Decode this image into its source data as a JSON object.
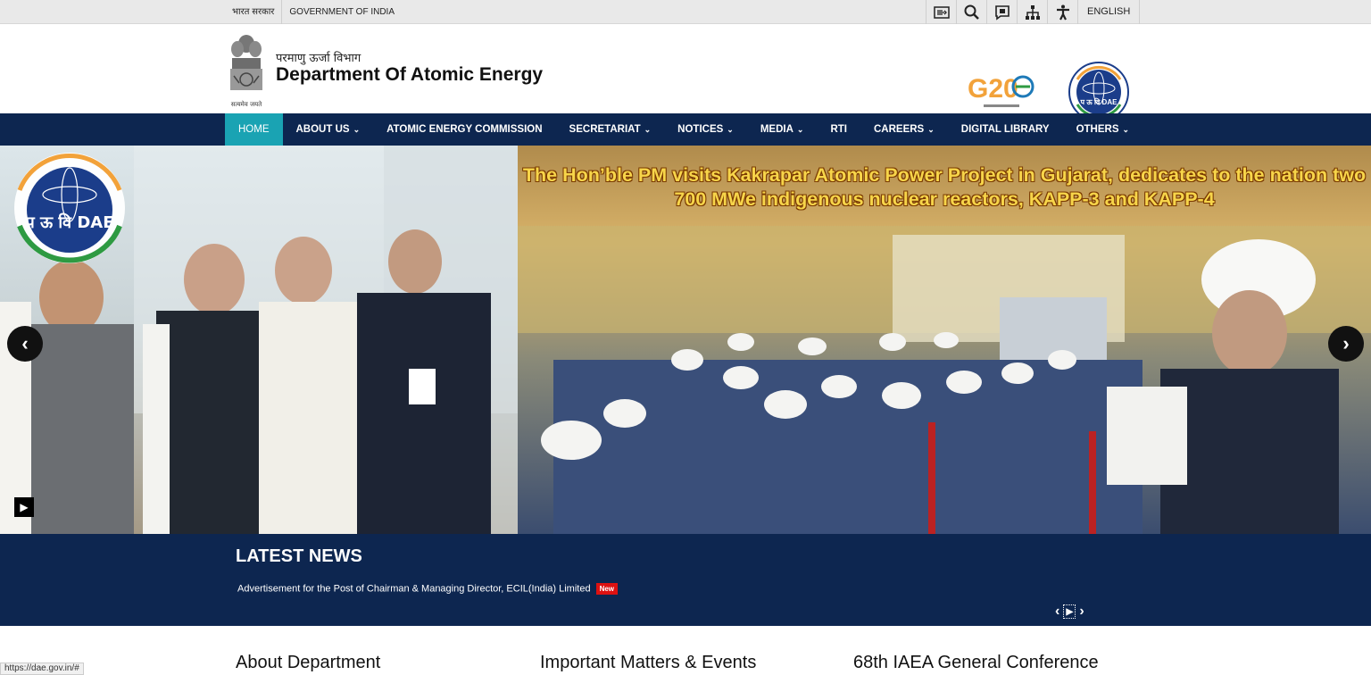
{
  "topbar": {
    "gov_hindi": "भारत सरकार",
    "gov_english": "GOVERNMENT OF INDIA",
    "tools": [
      "skip-to-content-icon",
      "search-icon",
      "screen-reader-icon",
      "sitemap-icon",
      "accessibility-icon"
    ],
    "language": "ENGLISH"
  },
  "header": {
    "emblem_motto": "सत्यमेव जयते",
    "dept_hindi": "परमाणु ऊर्जा विभाग",
    "dept_name": "Department Of Atomic Energy",
    "g20_text": "G20",
    "dae_logo_text": "प ऊ वि DAE"
  },
  "nav": {
    "items": [
      {
        "label": "HOME",
        "active": true
      },
      {
        "label": "ABOUT US",
        "dropdown": true
      },
      {
        "label": "ATOMIC ENERGY COMMISSION"
      },
      {
        "label": "SECRETARIAT",
        "dropdown": true
      },
      {
        "label": "NOTICES",
        "dropdown": true
      },
      {
        "label": "MEDIA",
        "dropdown": true
      },
      {
        "label": "RTI"
      },
      {
        "label": "CAREERS",
        "dropdown": true
      },
      {
        "label": "DIGITAL LIBRARY"
      },
      {
        "label": "OTHERS",
        "dropdown": true
      }
    ]
  },
  "slider": {
    "caption": "The Hon’ble PM visits Kakrapar Atomic Power Project in Gujarat, dedicates to the nation two 700 MWe indigenous nuclear reactors, KAPP-3 and KAPP-4",
    "logo_text": "प ऊ वि DAE"
  },
  "news": {
    "title": "LATEST NEWS",
    "item": "Advertisement for the Post of Chairman & Managing Director, ECIL(India) Limited",
    "badge": "New"
  },
  "sections": {
    "about": "About Department",
    "matters": "Important Matters & Events",
    "iaea": "68th IAEA General Conference"
  },
  "status_url": "https://dae.gov.in/#",
  "colors": {
    "nav_bg": "#0d2650",
    "active_tab": "#1aa3b3",
    "caption": "#f7d54a",
    "badge": "#dd1111"
  }
}
